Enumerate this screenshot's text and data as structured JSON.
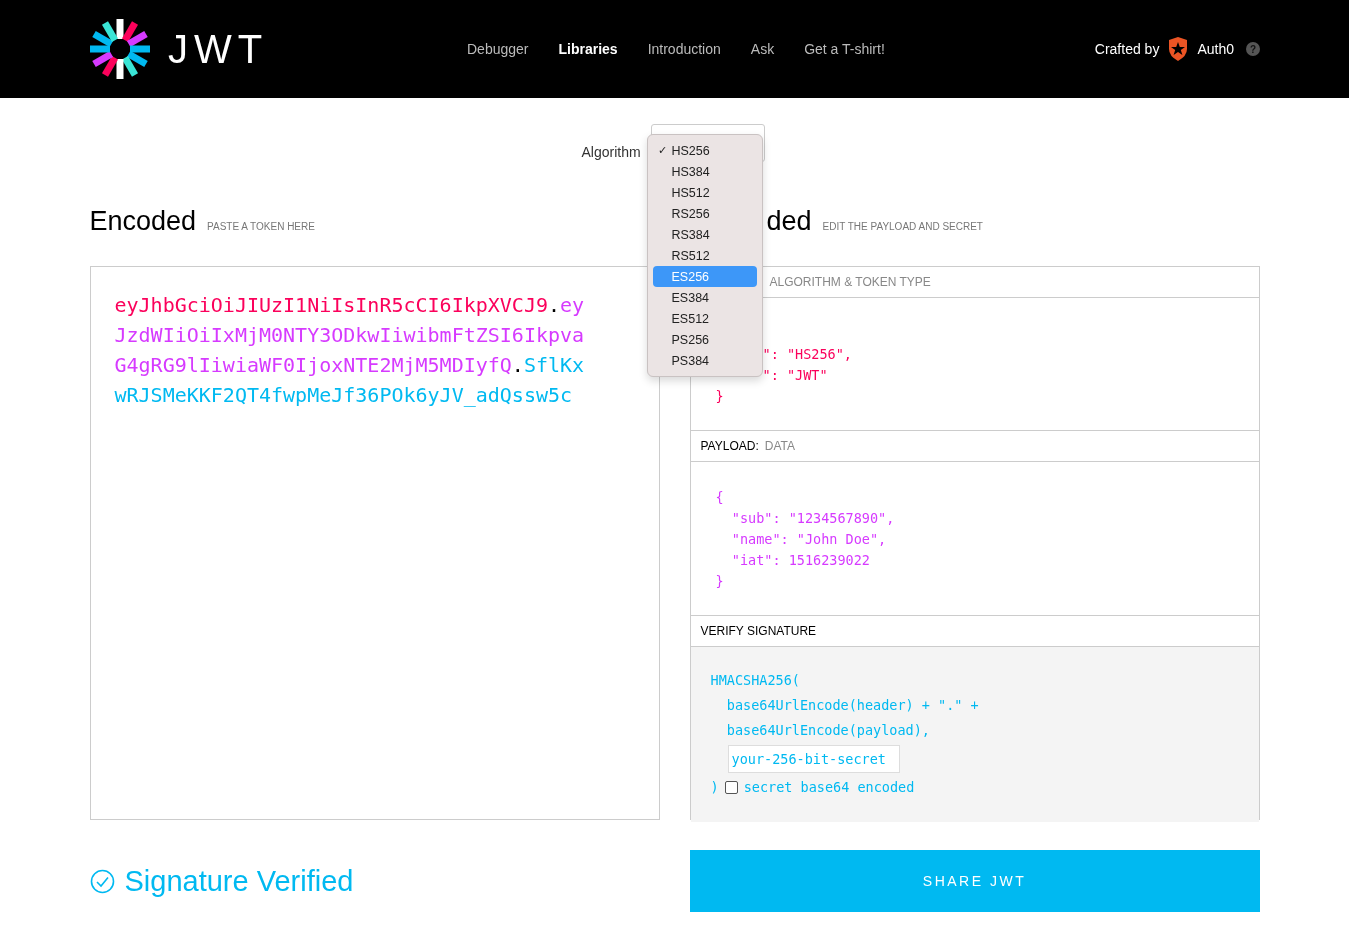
{
  "nav": {
    "logo_text": "JWT",
    "links": [
      {
        "label": "Debugger",
        "selected": false
      },
      {
        "label": "Libraries",
        "selected": true
      },
      {
        "label": "Introduction",
        "selected": false
      },
      {
        "label": "Ask",
        "selected": false
      },
      {
        "label": "Get a T-shirt!",
        "selected": false
      }
    ],
    "crafted_by": "Crafted by",
    "brand": "Auth0",
    "help": "?"
  },
  "algorithm": {
    "label": "Algorithm",
    "check_mark": "✓",
    "options": [
      {
        "label": "HS256",
        "checked": true,
        "highlighted": false
      },
      {
        "label": "HS384",
        "checked": false,
        "highlighted": false
      },
      {
        "label": "HS512",
        "checked": false,
        "highlighted": false
      },
      {
        "label": "RS256",
        "checked": false,
        "highlighted": false
      },
      {
        "label": "RS384",
        "checked": false,
        "highlighted": false
      },
      {
        "label": "RS512",
        "checked": false,
        "highlighted": false
      },
      {
        "label": "ES256",
        "checked": false,
        "highlighted": true
      },
      {
        "label": "ES384",
        "checked": false,
        "highlighted": false
      },
      {
        "label": "ES512",
        "checked": false,
        "highlighted": false
      },
      {
        "label": "PS256",
        "checked": false,
        "highlighted": false
      },
      {
        "label": "PS384",
        "checked": false,
        "highlighted": false
      }
    ]
  },
  "encoded": {
    "title": "Encoded",
    "hint": "PASTE A TOKEN HERE",
    "token": [
      {
        "kind": "header",
        "text": "eyJhbGciOiJIUzI1NiIsInR5cCI6IkpXVCJ9"
      },
      {
        "kind": "dot",
        "text": "."
      },
      {
        "kind": "payload",
        "text": "eyJzdWIiOiIxMjM0NTY3ODkwIiwibmFtZSI6IkpvaG4gRG9lIiwiaWF0IjoxNTE2MjM5MDIyfQ"
      },
      {
        "kind": "dot",
        "text": "."
      },
      {
        "kind": "signature",
        "text": "SflKxwRJSMeKKF2QT4fwpMeJf36POk6yJV_adQssw5c"
      }
    ]
  },
  "decoded": {
    "title": "ded",
    "hint": "EDIT THE PAYLOAD AND SECRET",
    "header": {
      "hint": "ALGORITHM & TOKEN TYPE",
      "lines": [
        "\": \"HS256\",",
        "\": \"JWT\"",
        "}"
      ]
    },
    "payload": {
      "label": "PAYLOAD:",
      "hint": "DATA",
      "lines": [
        "{",
        "  \"sub\": \"1234567890\",",
        "  \"name\": \"John Doe\",",
        "  \"iat\": 1516239022",
        "}"
      ]
    },
    "signature": {
      "label": "VERIFY SIGNATURE",
      "lines": [
        "HMACSHA256(",
        "  base64UrlEncode(header) + \".\" +",
        "  base64UrlEncode(payload),"
      ],
      "secret": "your-256-bit-secret",
      "close": ")",
      "base64_checked": false,
      "base64_label": "secret base64 encoded"
    }
  },
  "status": "Signature Verified",
  "share_button": "SHARE JWT"
}
